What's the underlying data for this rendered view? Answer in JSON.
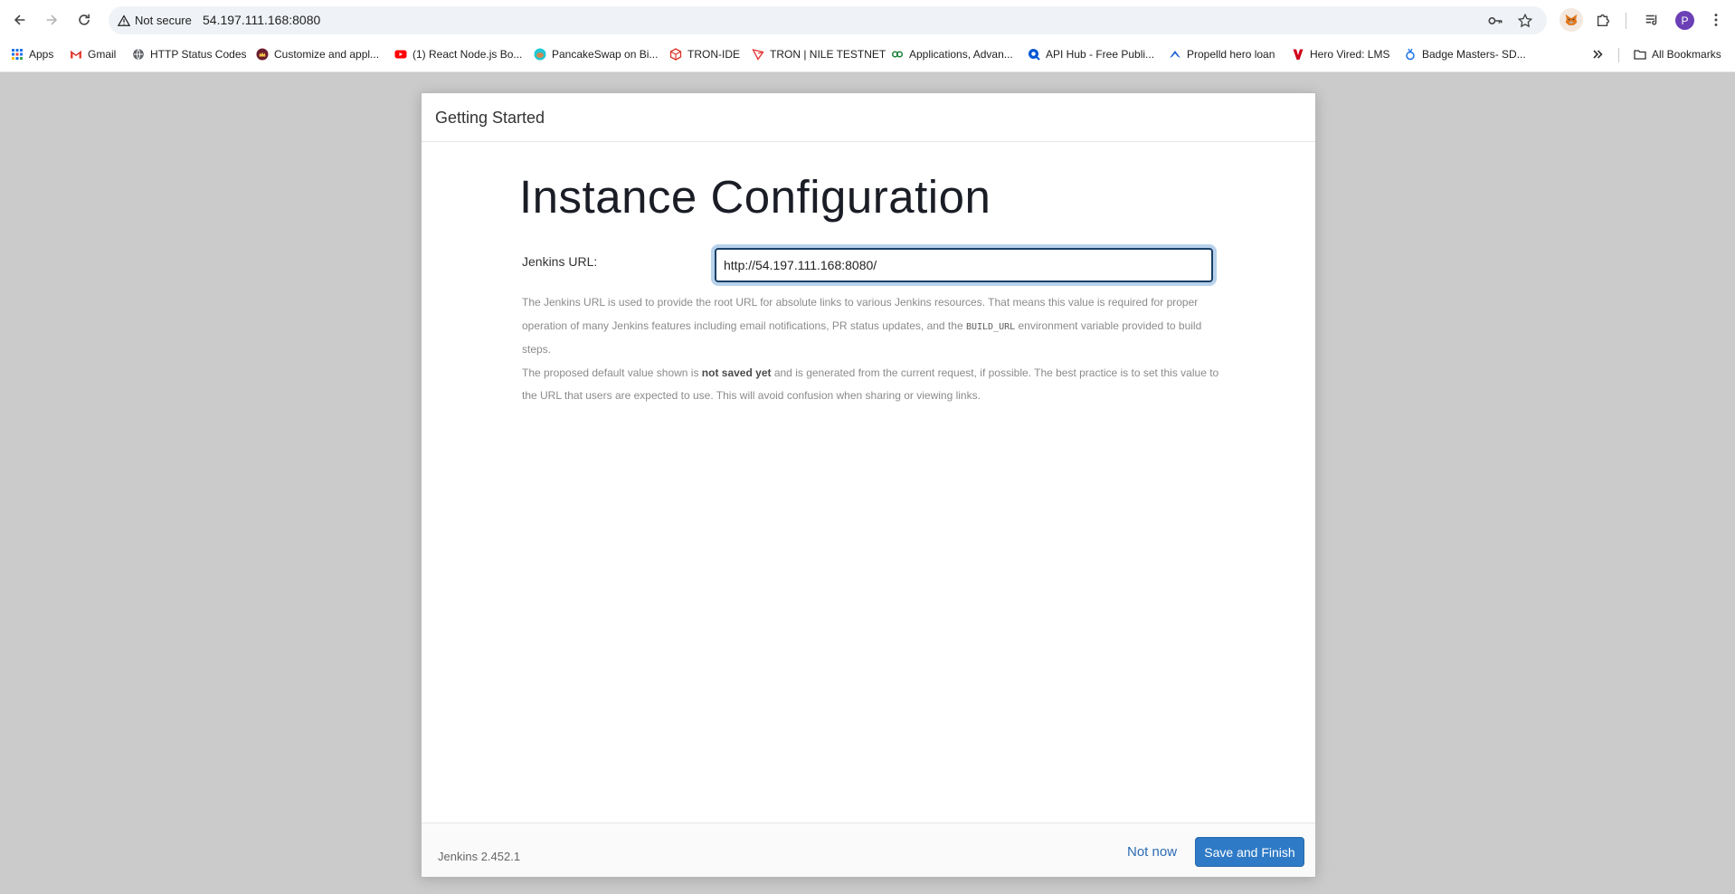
{
  "browser": {
    "security_label": "Not secure",
    "address": "54.197.111.168:8080",
    "avatar_letter": "P",
    "bookmarks": [
      {
        "label": "Apps",
        "icon": "apps-grid-icon"
      },
      {
        "label": "Gmail",
        "icon": "gmail-icon"
      },
      {
        "label": "HTTP Status Codes",
        "icon": "globe-icon"
      },
      {
        "label": "Customize and appl...",
        "icon": "crown-icon"
      },
      {
        "label": "(1) React Node.js Bo...",
        "icon": "youtube-icon"
      },
      {
        "label": "PancakeSwap on Bi...",
        "icon": "pancakeswap-icon"
      },
      {
        "label": "TRON-IDE",
        "icon": "tron-ide-icon"
      },
      {
        "label": "TRON | NILE TESTNET",
        "icon": "tron-icon"
      },
      {
        "label": "Applications, Advan...",
        "icon": "link-icon"
      },
      {
        "label": "API Hub - Free Publi...",
        "icon": "api-hub-icon"
      },
      {
        "label": "Propelld hero loan",
        "icon": "propelld-icon"
      },
      {
        "label": "Hero Vired: LMS",
        "icon": "hero-vired-icon"
      },
      {
        "label": "Badge Masters- SD...",
        "icon": "badge-icon"
      }
    ],
    "all_bookmarks": "All Bookmarks",
    "colors": {
      "avatar": "#6b3fb6",
      "omnibox": "#eff2f6",
      "page_background": "#cbcbcb"
    }
  },
  "dialog": {
    "header": "Getting Started",
    "title": "Instance Configuration",
    "url_label": "Jenkins URL:",
    "url_value": "http://54.197.111.168:8080/",
    "help": {
      "p1_a": "The Jenkins URL is used to provide the root URL for absolute links to various Jenkins resources. That means this value is required for proper operation of many Jenkins features including email notifications, PR status updates, and the ",
      "p1_code": "BUILD_URL",
      "p1_b": " environment variable provided to build steps.",
      "p2_a": "The proposed default value shown is ",
      "p2_bold": "not saved yet",
      "p2_b": " and is generated from the current request, if possible. The best practice is to set this value to the URL that users are expected to use. This will avoid confusion when sharing or viewing links."
    },
    "footer": {
      "version": "Jenkins 2.452.1",
      "not_now": "Not now",
      "save": "Save and Finish"
    },
    "colors": {
      "primary_button": "#2f7ac6",
      "link": "#2b6cb5",
      "input_focus": "#1a3f66"
    }
  }
}
